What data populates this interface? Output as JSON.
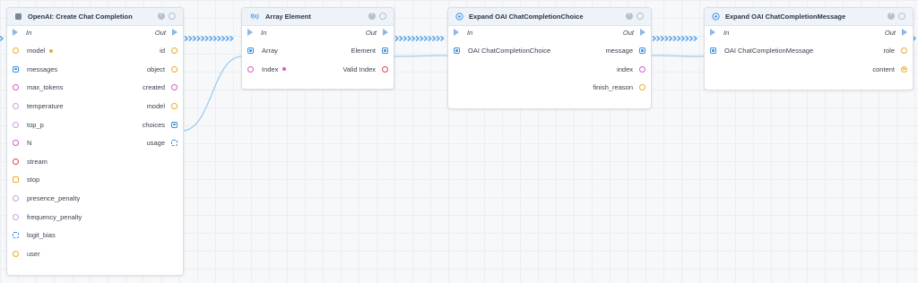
{
  "colors": {
    "exec": "#5aa6e8",
    "string": "#f0a92a",
    "struct": "#3d8fe0",
    "integer": "#d05dc8",
    "float": "#c8a0e0",
    "boolean": "#d84a4a",
    "wildcard": "#3d8fe0"
  },
  "nodes": [
    {
      "key": "create",
      "title": "OpenAI: Create Chat Completion",
      "icon": "openai-icon",
      "exec_in": "In",
      "exec_out": "Out",
      "inputs": [
        {
          "label": "model",
          "type": "string",
          "required": true
        },
        {
          "label": "messages",
          "type": "struct"
        },
        {
          "label": "max_tokens",
          "type": "integer"
        },
        {
          "label": "temperature",
          "type": "float"
        },
        {
          "label": "top_p",
          "type": "float"
        },
        {
          "label": "N",
          "type": "integer"
        },
        {
          "label": "stream",
          "type": "boolean"
        },
        {
          "label": "stop",
          "type": "string-array"
        },
        {
          "label": "presence_penalty",
          "type": "float"
        },
        {
          "label": "frequency_penalty",
          "type": "float"
        },
        {
          "label": "logit_bias",
          "type": "map"
        },
        {
          "label": "user",
          "type": "string"
        }
      ],
      "outputs": [
        {
          "label": "id",
          "type": "string"
        },
        {
          "label": "object",
          "type": "string"
        },
        {
          "label": "created",
          "type": "integer"
        },
        {
          "label": "model",
          "type": "string"
        },
        {
          "label": "choices",
          "type": "struct"
        },
        {
          "label": "usage",
          "type": "map"
        }
      ]
    },
    {
      "key": "array",
      "title": "Array Element",
      "icon": "function-icon",
      "icon_text": "f(x)",
      "exec_in": "In",
      "exec_out": "Out",
      "inputs": [
        {
          "label": "Array",
          "type": "struct"
        },
        {
          "label": "Index",
          "type": "integer",
          "required": true
        }
      ],
      "outputs": [
        {
          "label": "Element",
          "type": "struct"
        },
        {
          "label": "Valid Index",
          "type": "boolean"
        }
      ]
    },
    {
      "key": "choice",
      "title": "Expand OAI ChatCompletionChoice",
      "icon": "expand-icon",
      "exec_in": "In",
      "exec_out": "Out",
      "inputs": [
        {
          "label": "OAI ChatCompletionChoice",
          "type": "struct"
        }
      ],
      "outputs": [
        {
          "label": "message",
          "type": "struct"
        },
        {
          "label": "index",
          "type": "integer"
        },
        {
          "label": "finish_reason",
          "type": "string"
        }
      ]
    },
    {
      "key": "message",
      "title": "Expand OAI ChatCompletionMessage",
      "icon": "expand-icon",
      "exec_in": "In",
      "exec_out": "Out",
      "inputs": [
        {
          "label": "OAI ChatCompletionMessage",
          "type": "struct"
        }
      ],
      "outputs": [
        {
          "label": "role",
          "type": "string"
        },
        {
          "label": "content",
          "type": "string",
          "filled": true
        }
      ]
    }
  ]
}
